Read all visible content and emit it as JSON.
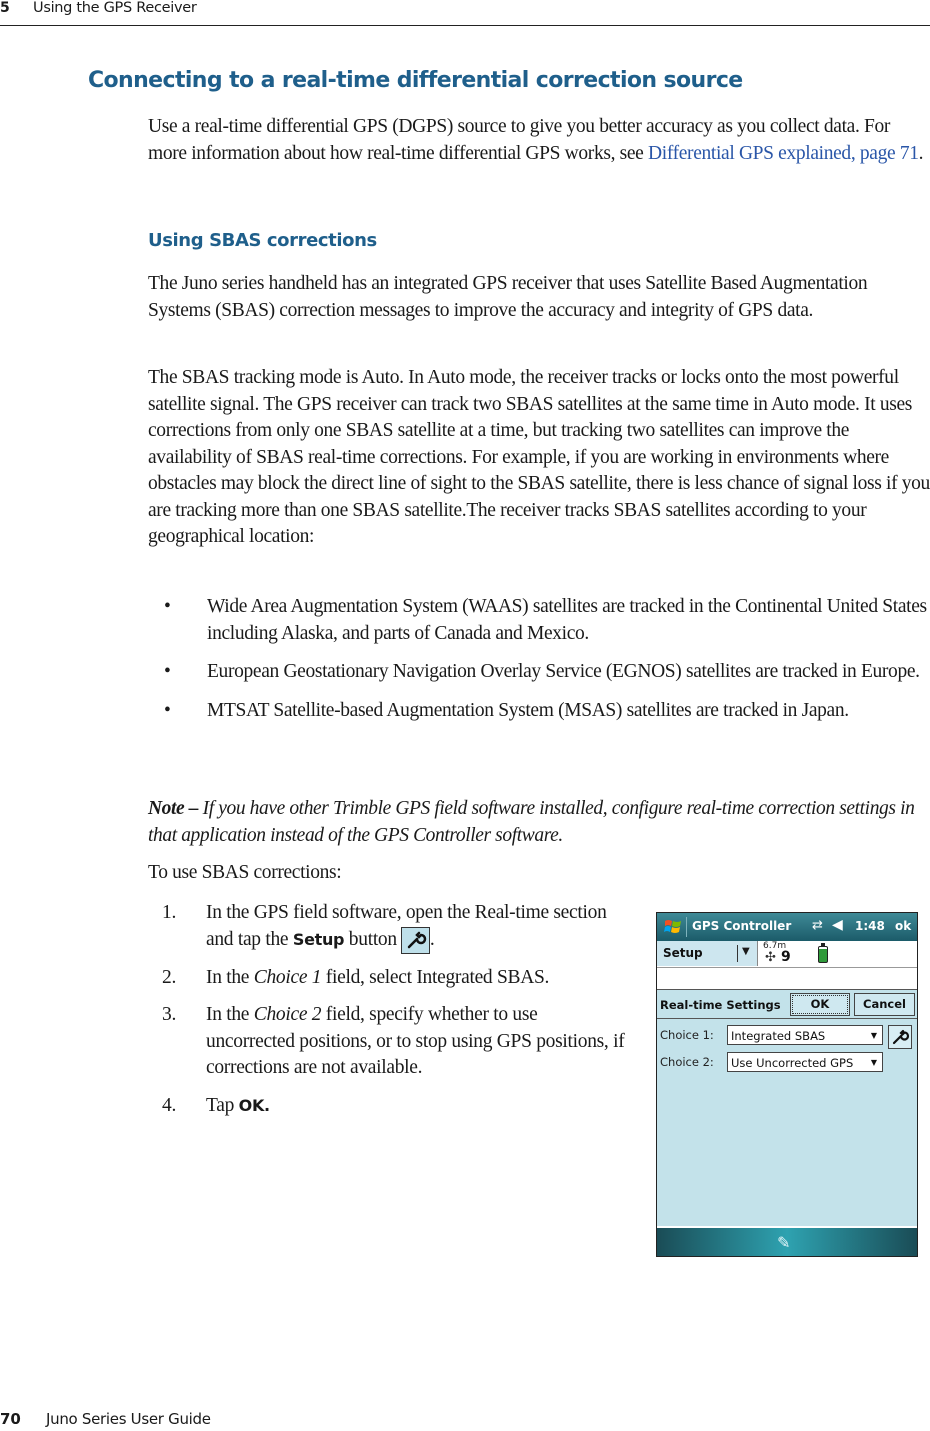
{
  "running_header": {
    "chapter_number": "5",
    "chapter_title": "Using the GPS Receiver"
  },
  "section": {
    "heading": "Connecting to a real-time differential correction source",
    "intro": "Use a real-time differential GPS (DGPS) source to give you better accuracy as you collect data. For more information about how real-time differential GPS works, see",
    "intro_link": "Differential GPS explained, page 71",
    "intro_end": "."
  },
  "subsection": {
    "heading": "Using SBAS corrections",
    "para1": "The Juno series handheld has an integrated GPS receiver that uses Satellite Based Augmentation Systems (SBAS) correction messages to improve the accuracy and integrity of GPS data.",
    "para2": "The SBAS tracking mode is Auto. In Auto mode, the receiver tracks or locks onto the most powerful satellite signal. The GPS receiver can track two SBAS satellites at the same time in Auto mode. It uses corrections from only one SBAS satellite at a time, but tracking two satellites can improve the availability of SBAS real-time corrections. For example, if you are working in environments where obstacles may block the direct line of sight to the SBAS satellite, there is less chance of signal loss if you are tracking more than one SBAS satellite.The receiver tracks SBAS satellites according to your geographical location:",
    "bullet_glyph": "•",
    "bullets": [
      "Wide Area Augmentation System (WAAS) satellites are tracked in the Continental United States including Alaska, and parts of Canada and Mexico.",
      "European Geostationary Navigation Overlay Service (EGNOS) satellites are tracked in Europe.",
      "MTSAT Satellite-based Augmentation System (MSAS) satellites are tracked in Japan."
    ],
    "note_label": "Note –",
    "note_text": "If you have other Trimble GPS field software installed, configure real-time correction settings in that application instead of the GPS Controller software.",
    "steps_intro": "To use SBAS corrections:",
    "steps": [
      {
        "num": "1.",
        "pre": "In the GPS field software, open the Real-time section and tap the",
        "bold": "Setup",
        "post": "button",
        "icon": "wrench-icon",
        "end": "."
      },
      {
        "num": "2.",
        "pre": "In the",
        "italic": "Choice 1",
        "post": "field, select Integrated SBAS."
      },
      {
        "num": "3.",
        "pre": "In the",
        "italic": "Choice 2",
        "post": "field, specify whether to use uncorrected positions, or to stop using GPS positions, if corrections are not available."
      },
      {
        "num": "4.",
        "pre": "Tap",
        "bold": "OK."
      }
    ]
  },
  "device": {
    "app_title": "GPS Controller",
    "connectivity_icon": "⇄",
    "volume_icon": "◀",
    "time": "1:48",
    "ok_label": "ok",
    "menu_label": "Setup",
    "menu_arrow": "▼",
    "accuracy": "6.7m",
    "satellite_icon": "✣",
    "satellite_count": "9",
    "panel_title": "Real-time Settings",
    "ok_button": "OK",
    "cancel_button": "Cancel",
    "choice1_label": "Choice 1:",
    "choice1_value": "Integrated SBAS",
    "choice2_label": "Choice 2:",
    "choice2_value": "Use Uncorrected GPS",
    "caret": "▼",
    "pen_icon": "✎"
  },
  "footer": {
    "page_number": "70",
    "book_title": "Juno Series User Guide"
  }
}
